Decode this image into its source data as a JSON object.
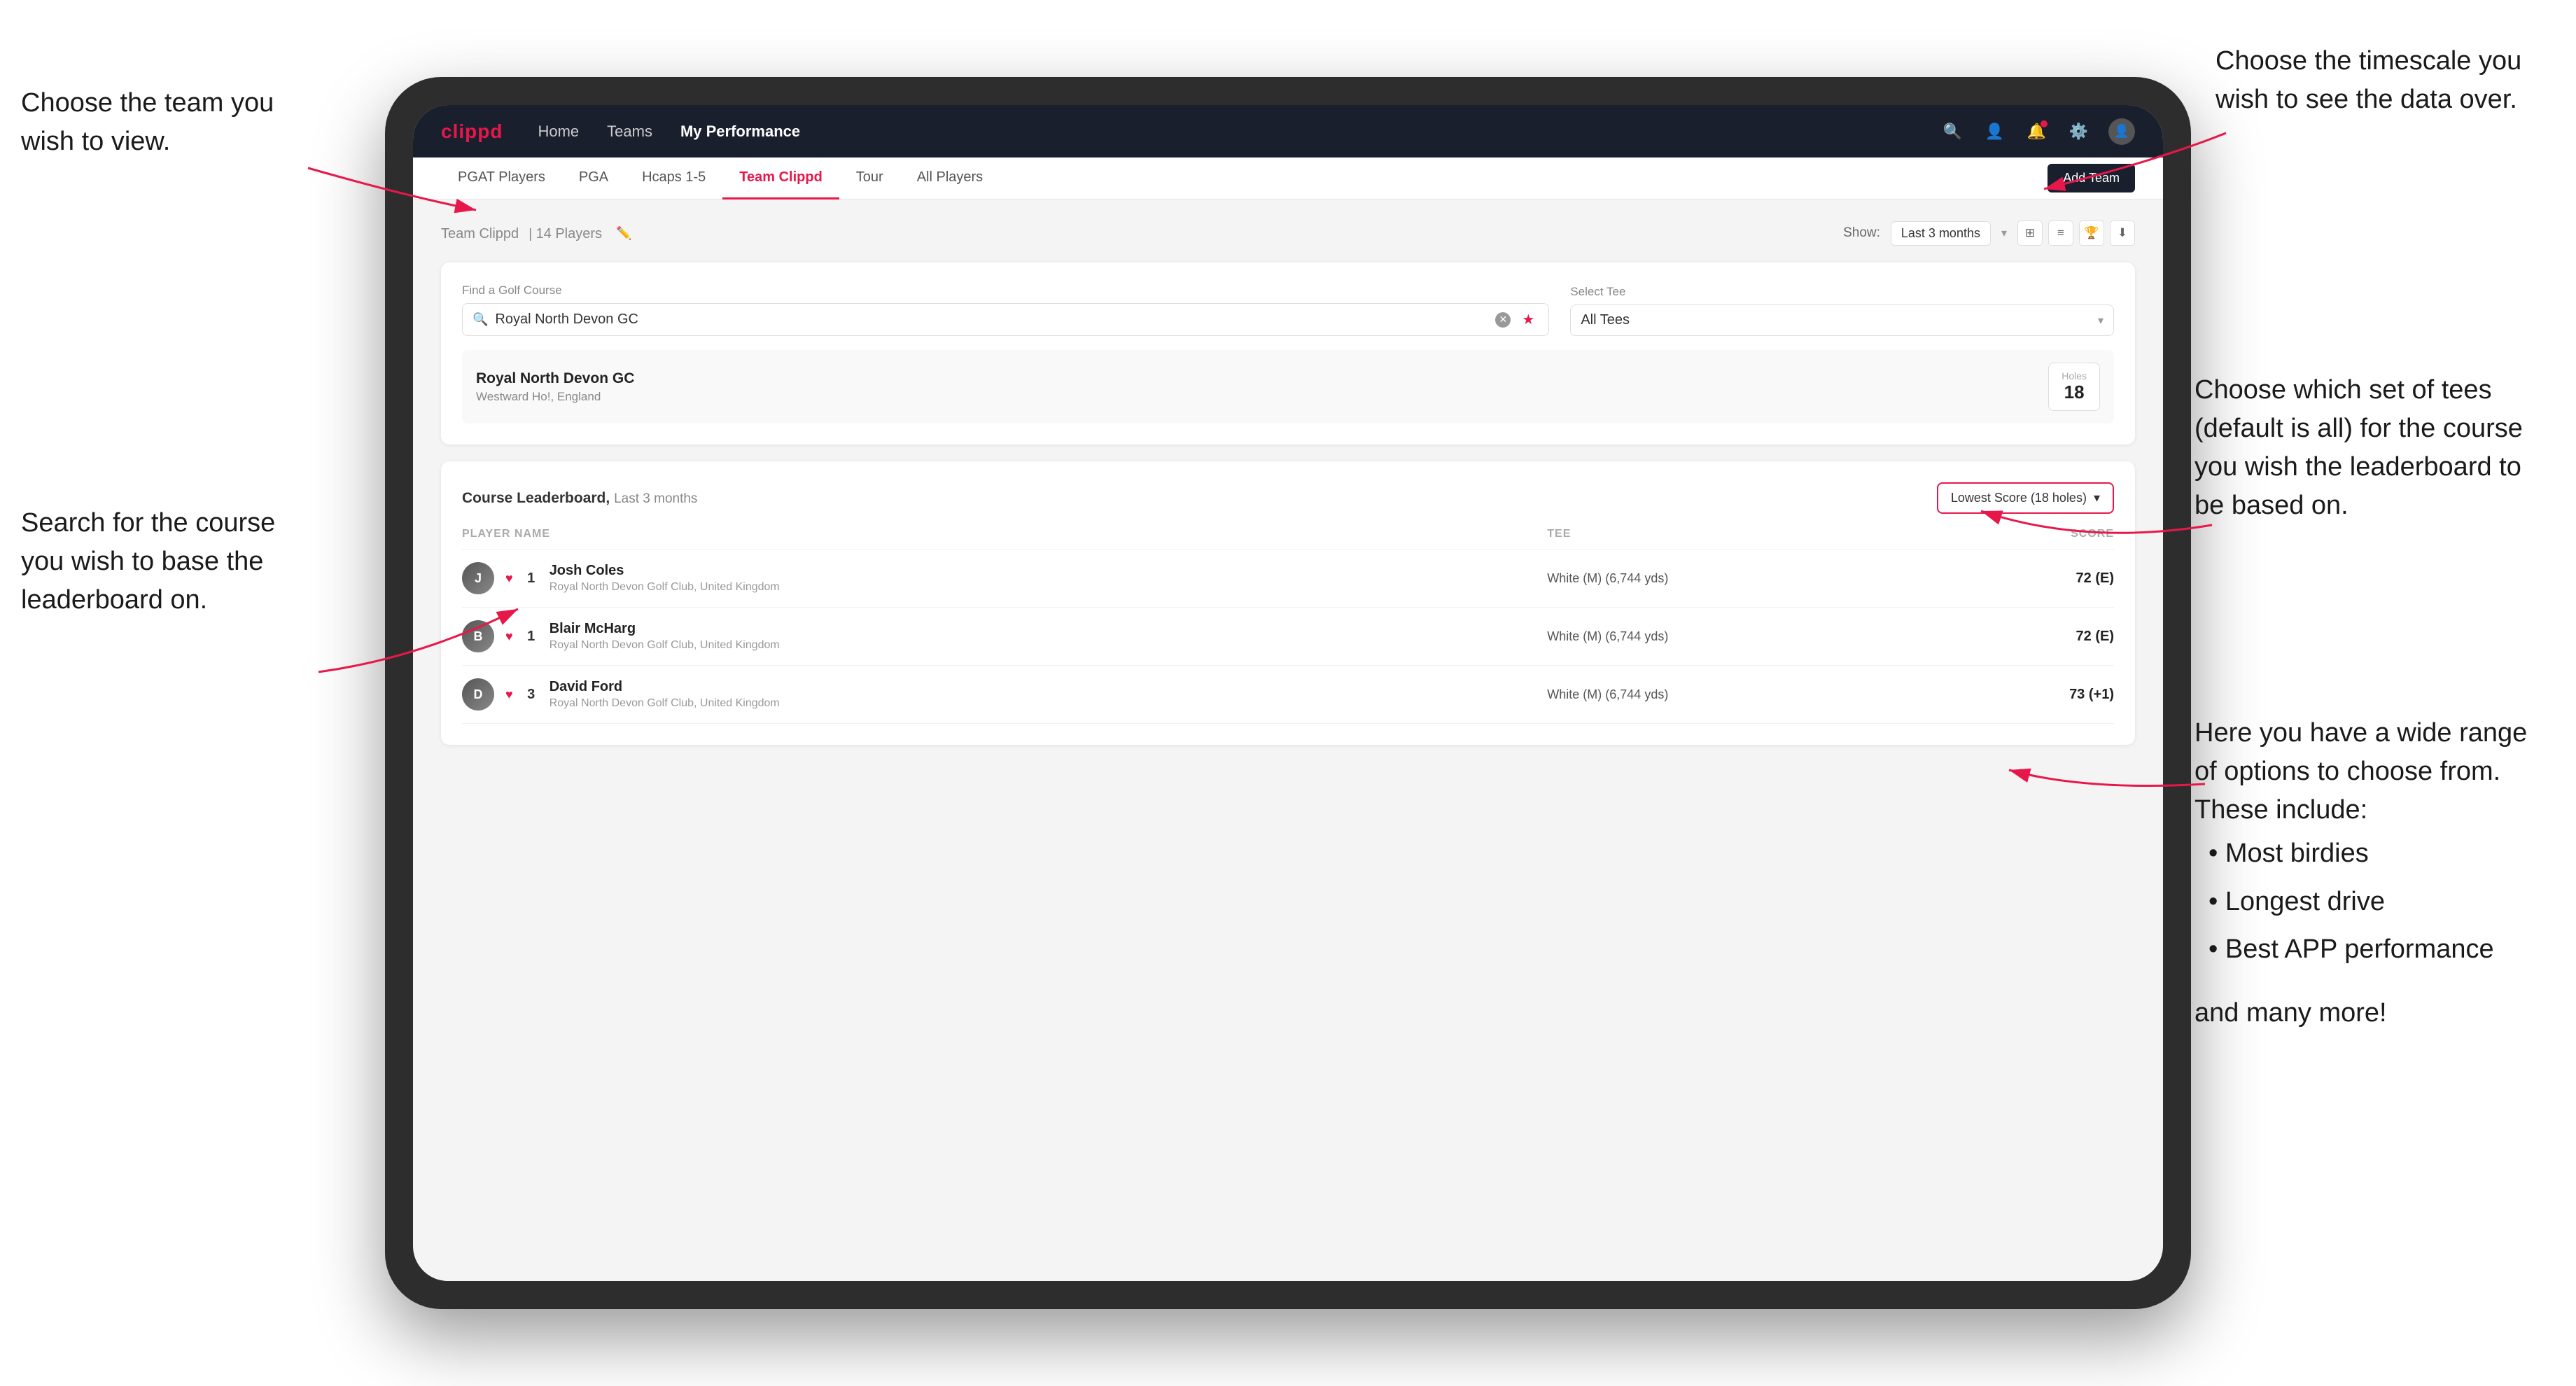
{
  "annotations": {
    "top_left": {
      "line1": "Choose the team you",
      "line2": "wish to view."
    },
    "top_right": {
      "line1": "Choose the timescale you",
      "line2": "wish to see the data over."
    },
    "right_middle": {
      "line1": "Choose which set of tees",
      "line2": "(default is all) for the course",
      "line3": "you wish the leaderboard to",
      "line4": "be based on."
    },
    "bottom_left": {
      "line1": "Search for the course",
      "line2": "you wish to base the",
      "line3": "leaderboard on."
    },
    "right_bottom": {
      "title": "Here you have a wide range",
      "title2": "of options to choose from.",
      "title3": "These include:",
      "bullets": [
        "Most birdies",
        "Longest drive",
        "Best APP performance"
      ],
      "extra": "and many more!"
    }
  },
  "nav": {
    "logo": "clippd",
    "links": [
      "Home",
      "Teams",
      "My Performance"
    ],
    "active_link": "My Performance"
  },
  "sub_nav": {
    "items": [
      "PGAT Players",
      "PGA",
      "Hcaps 1-5",
      "Team Clippd",
      "Tour",
      "All Players"
    ],
    "active": "Team Clippd",
    "add_button": "Add Team"
  },
  "team_header": {
    "title": "Team Clippd",
    "count": "14 Players",
    "show_label": "Show:",
    "show_value": "Last 3 months"
  },
  "course_search": {
    "find_label": "Find a Golf Course",
    "search_placeholder": "Royal North Devon GC",
    "tee_label": "Select Tee",
    "tee_value": "All Tees"
  },
  "course_result": {
    "name": "Royal North Devon GC",
    "location": "Westward Ho!, England",
    "holes_label": "Holes",
    "holes_value": "18"
  },
  "leaderboard": {
    "title": "Course Leaderboard,",
    "subtitle": "Last 3 months",
    "dropdown": "Lowest Score (18 holes)",
    "columns": {
      "player": "PLAYER NAME",
      "tee": "TEE",
      "score": "SCORE"
    },
    "players": [
      {
        "rank": "1",
        "name": "Josh Coles",
        "club": "Royal North Devon Golf Club, United Kingdom",
        "tee": "White (M) (6,744 yds)",
        "score": "72 (E)"
      },
      {
        "rank": "1",
        "name": "Blair McHarg",
        "club": "Royal North Devon Golf Club, United Kingdom",
        "tee": "White (M) (6,744 yds)",
        "score": "72 (E)"
      },
      {
        "rank": "3",
        "name": "David Ford",
        "club": "Royal North Devon Golf Club, United Kingdom",
        "tee": "White (M) (6,744 yds)",
        "score": "73 (+1)"
      }
    ]
  }
}
